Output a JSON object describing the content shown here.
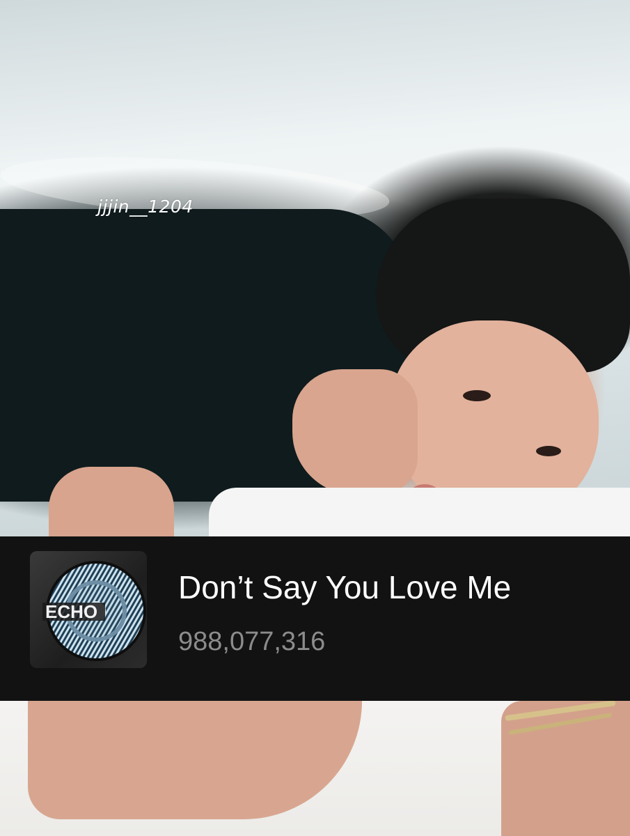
{
  "photo": {
    "description_icon": "photo-background"
  },
  "watermark": {
    "text": "jjjin__1204"
  },
  "track": {
    "cover_icon": "album-cover-echo",
    "cover_text": "ECHO",
    "title": "Don’t Say You Love Me",
    "play_count": "988,077,316"
  },
  "colors": {
    "card_background": "#121212",
    "title_color": "#ffffff",
    "count_color": "#8c8c8c"
  }
}
